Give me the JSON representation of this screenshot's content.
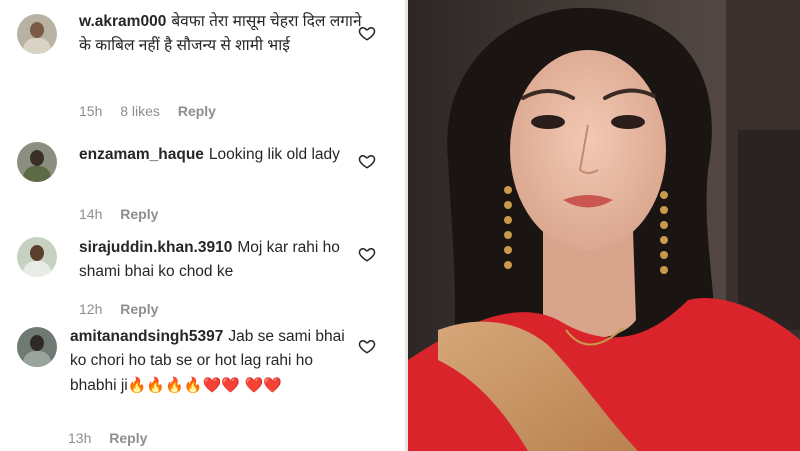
{
  "comments": [
    {
      "username": "w.akram000",
      "text": "बेवफा तेरा मासूम चेहरा दिल लगाने के काबिल नहीं है सौजन्य से शामी भाई",
      "time": "15h",
      "likes": "8 likes",
      "reply": "Reply",
      "avatar_colors": {
        "bg": "#b8b2a3",
        "head": "#7a5b43",
        "body": "#d9d3c4"
      }
    },
    {
      "username": "enzamam_haque",
      "text": "Looking lik old lady",
      "time": "14h",
      "likes": "",
      "reply": "Reply",
      "avatar_colors": {
        "bg": "#8a8f7f",
        "head": "#3b2f27",
        "body": "#5d6b45"
      }
    },
    {
      "username": "sirajuddin.khan.3910",
      "text": "Moj kar rahi ho shami bhai ko chod ke",
      "time": "12h",
      "likes": "",
      "reply": "Reply",
      "avatar_colors": {
        "bg": "#c7d1c2",
        "head": "#5a3e2e",
        "body": "#e9ece6"
      }
    },
    {
      "username": "amitanandsingh5397",
      "text": "Jab se sami bhai ko chori ho tab se or hot lag rahi ho bhabhi ji",
      "emojis": "🔥🔥🔥🔥❤️❤️ ❤️❤️",
      "time": "13h",
      "likes": "",
      "reply": "Reply",
      "avatar_colors": {
        "bg": "#6f7a73",
        "head": "#2f2a28",
        "body": "#9aa39c"
      }
    }
  ],
  "colors": {
    "text": "#262626",
    "meta": "#8e8e8e",
    "heart_outline": "#262626",
    "saree_red": "#d9242b",
    "saree_border": "#c9925f"
  },
  "icons": {
    "like": "heart-outline-icon"
  }
}
